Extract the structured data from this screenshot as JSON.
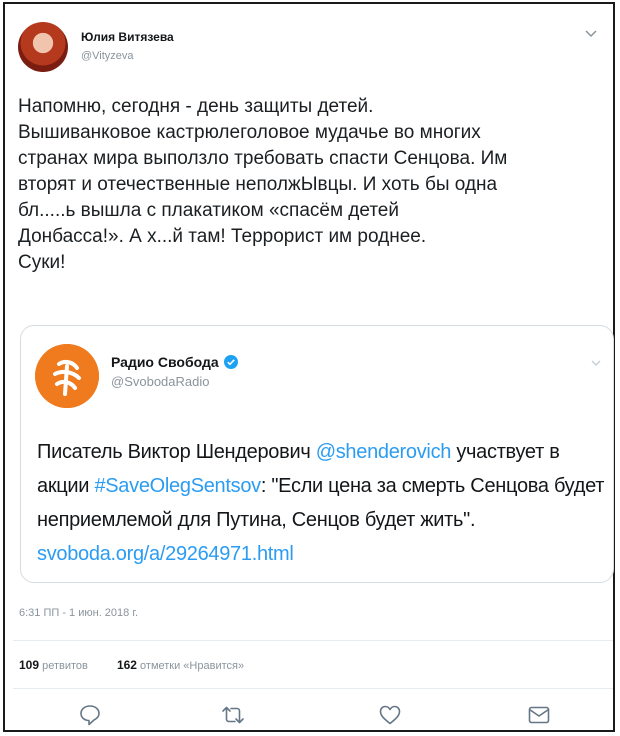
{
  "author": {
    "name": "Юлия Витязева",
    "handle": "@Vityzeva"
  },
  "tweet": {
    "text": "Напомню, сегодня - день защиты детей.\nВышиванковое кастрюлеголовое мудачье во многих\nстранах мира выползло требовать спасти Сенцова. Им\nвторят и отечественные неполжЫвцы. И хоть бы одна\nбл.....ь вышла с плакатиком «спасём детей\nДонбасса!». А    х...й там! Террорист им роднее.\nСуки!"
  },
  "quoted": {
    "name": "Радио Свобода",
    "handle": "@SvobodaRadio",
    "text_1": "Писатель Виктор Шендерович ",
    "mention": "@shenderovich",
    "text_2": " участвует в акции ",
    "hashtag": "#SaveOlegSentsov",
    "text_3": ": \"Если цена за смерть Сенцова будет неприемлемой для Путина, Сенцов будет жить\". ",
    "link": "svoboda.org/a/29264971.html"
  },
  "meta": {
    "timestamp": "6:31 ПП - 1 июн. 2018 г."
  },
  "stats": {
    "retweets_count": "109",
    "retweets_label": "ретвитов",
    "likes_count": "162",
    "likes_label": "отметки «Нравится»"
  },
  "colors": {
    "link": "#2b9cf2",
    "brand_orange": "#f07a1e",
    "verified": "#1da1f2",
    "muted": "#8a949c"
  },
  "icons": [
    "chevron-down-icon",
    "verified-icon",
    "reply-icon",
    "retweet-icon",
    "like-icon",
    "message-icon",
    "svoboda-logo-icon"
  ]
}
